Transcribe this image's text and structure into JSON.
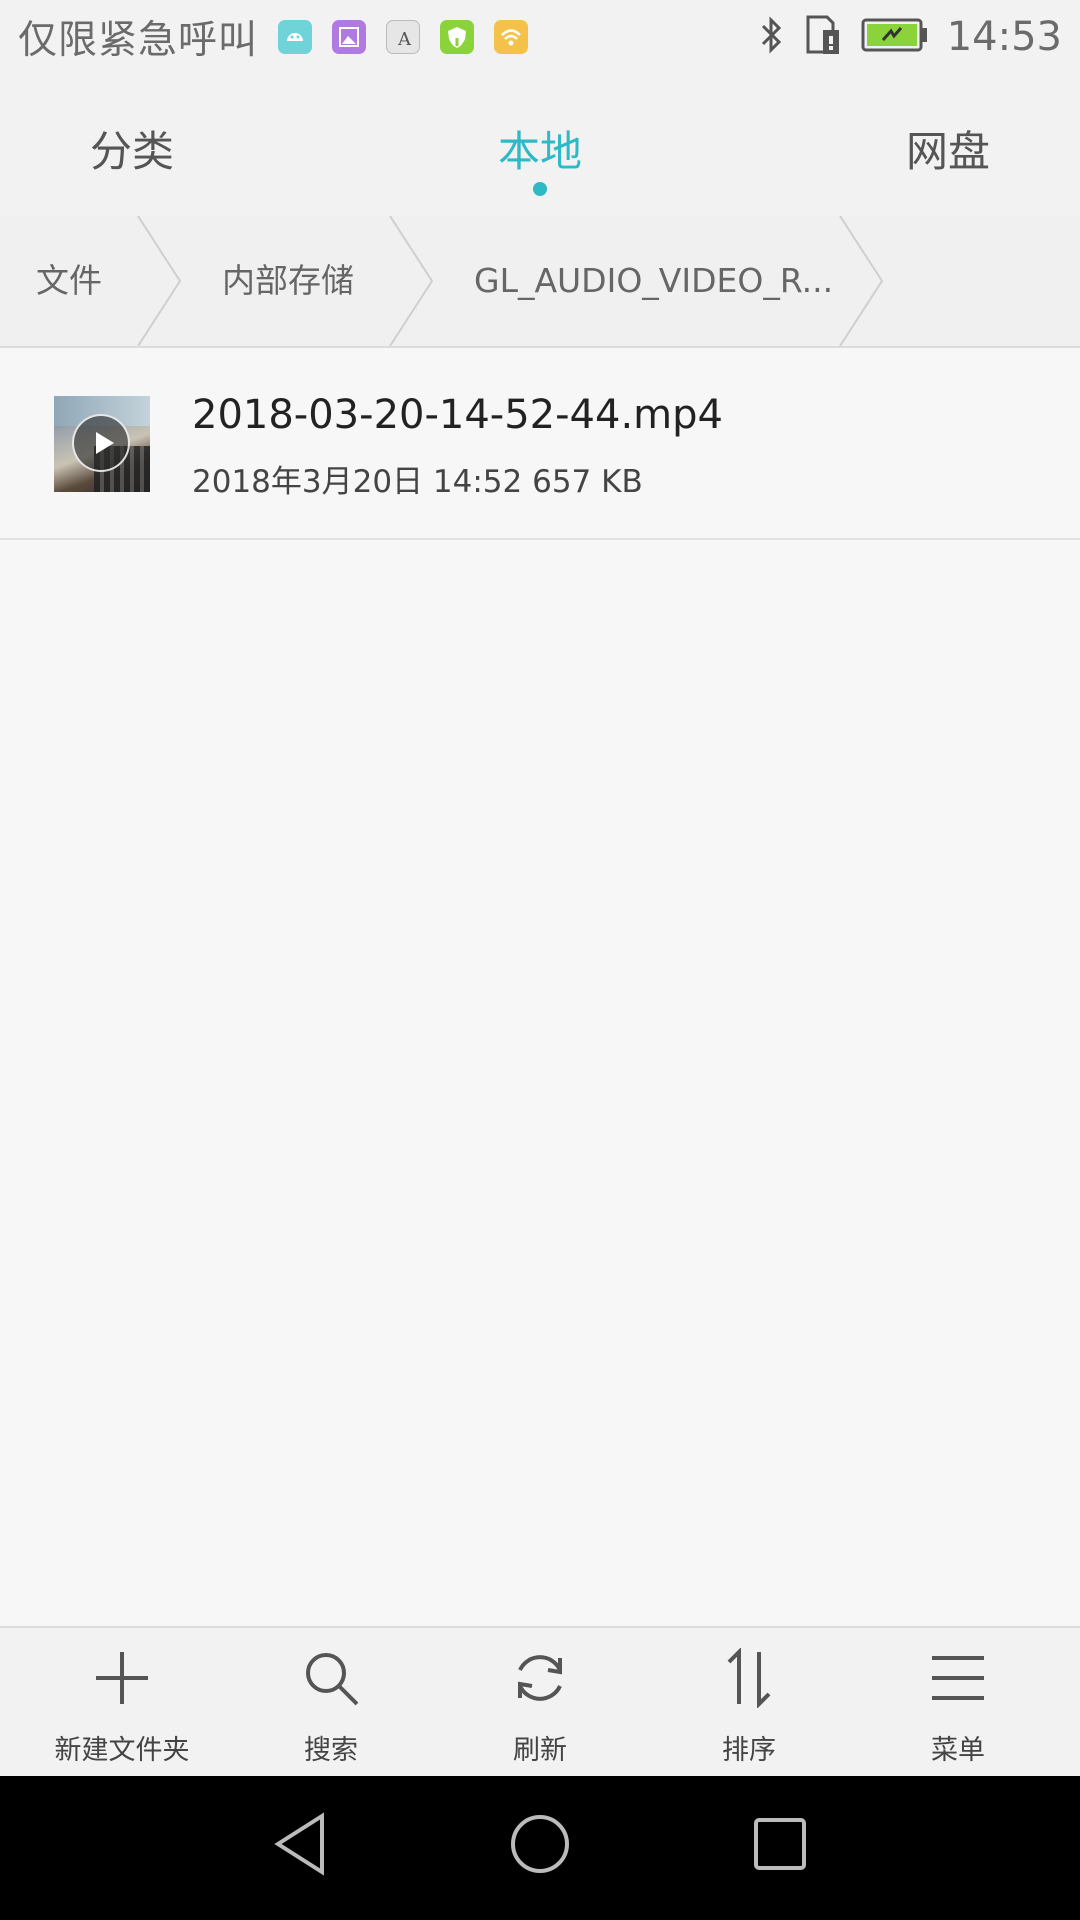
{
  "status_bar": {
    "carrier": "仅限紧急呼叫",
    "time": "14:53",
    "notification_icons": [
      "android-icon",
      "gallery-icon",
      "font-icon",
      "shield-icon",
      "wifi-icon"
    ],
    "status_icons": [
      "bluetooth-icon",
      "sim-icon",
      "battery-charging-icon"
    ]
  },
  "tabs": [
    {
      "label": "分类",
      "active": false
    },
    {
      "label": "本地",
      "active": true
    },
    {
      "label": "网盘",
      "active": false
    }
  ],
  "breadcrumb": [
    "文件",
    "内部存储",
    "GL_AUDIO_VIDEO_R..."
  ],
  "files": [
    {
      "name": "2018-03-20-14-52-44.mp4",
      "meta": "2018年3月20日 14:52 657 KB",
      "type": "video"
    }
  ],
  "toolbar": [
    {
      "label": "新建文件夹",
      "icon": "plus-icon"
    },
    {
      "label": "搜索",
      "icon": "search-icon"
    },
    {
      "label": "刷新",
      "icon": "refresh-icon"
    },
    {
      "label": "排序",
      "icon": "sort-icon"
    },
    {
      "label": "菜单",
      "icon": "menu-icon"
    }
  ],
  "colors": {
    "accent": "#2fb9c6"
  }
}
